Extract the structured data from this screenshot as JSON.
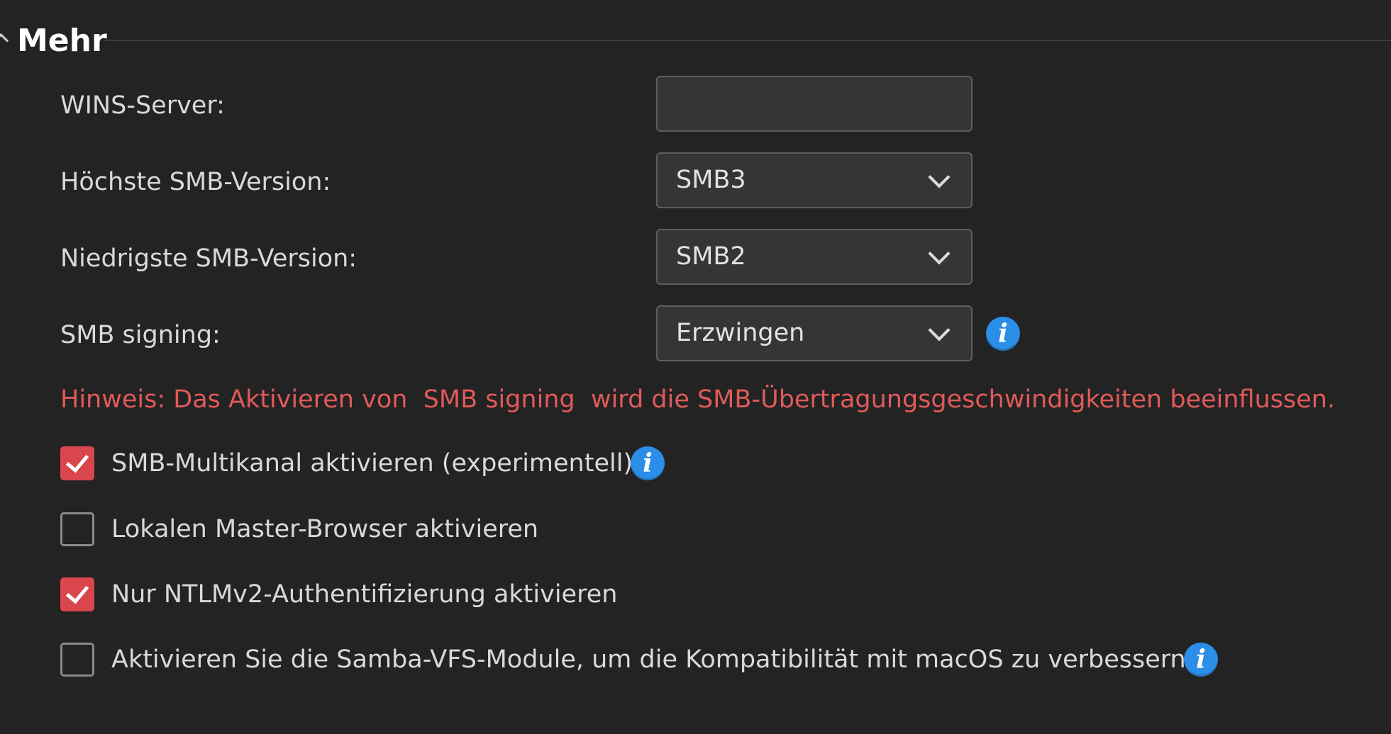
{
  "section": {
    "title": "Mehr"
  },
  "wins": {
    "label": "WINS-Server:",
    "value": ""
  },
  "max_smb": {
    "label": "Höchste SMB-Version:",
    "value": "SMB3"
  },
  "min_smb": {
    "label": "Niedrigste SMB-Version:",
    "value": "SMB2"
  },
  "signing": {
    "label": "SMB signing:",
    "value": "Erzwingen"
  },
  "hint": "Hinweis: Das Aktivieren von  SMB signing  wird die SMB-Übertragungsgeschwindigkeiten beeinflussen.",
  "checkboxes": [
    {
      "label": "SMB-Multikanal aktivieren (experimentell)",
      "checked": true
    },
    {
      "label": "Lokalen Master-Browser aktivieren",
      "checked": false
    },
    {
      "label": "Nur NTLMv2-Authentifizierung aktivieren",
      "checked": true
    },
    {
      "label": "Aktivieren Sie die Samba-VFS-Module, um die Kompatibilität mit macOS zu verbessern.",
      "checked": false
    }
  ],
  "icons": {
    "info": "i"
  },
  "colors": {
    "background": "#232323",
    "checkbox_checked": "#d9464b",
    "hint_text": "#e05a5a",
    "info_icon": "#2b8ee8"
  }
}
